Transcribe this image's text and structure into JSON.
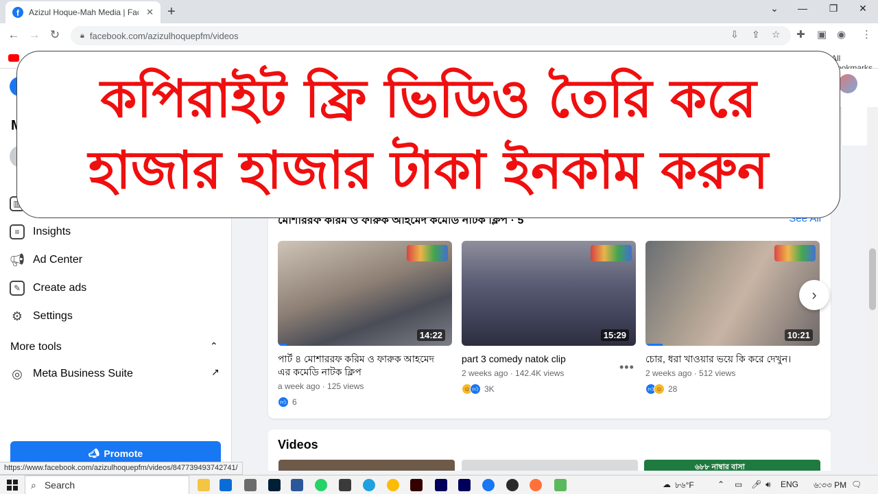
{
  "browser": {
    "tab_title": "Azizul Hoque-Mah Media | Faceb",
    "url": "facebook.com/azizulhoquepfm/videos",
    "bookmarks_label": "All Bookmarks",
    "status_url": "https://www.facebook.com/azizulhoquepfm/videos/847739493742741/"
  },
  "banner": {
    "line1": "কপিরাইট ফ্রি ভিডিও তৈরি করে",
    "line2": "হাজার হাজার টাকা ইনকাম করুন"
  },
  "sidebar": {
    "heading_initial": "M",
    "items": [
      {
        "label": "Insights",
        "icon": "insights-icon"
      },
      {
        "label": "Ad Center",
        "icon": "megaphone-icon"
      },
      {
        "label": "Create ads",
        "icon": "pencil-icon"
      },
      {
        "label": "Settings",
        "icon": "gear-icon"
      }
    ],
    "more_tools": "More tools",
    "meta_business_suite": "Meta Business Suite",
    "promote": "Promote"
  },
  "playlist": {
    "heading": "মোশাররফ করিম ও ফারুক আহমেদ কমেডি নাটক ক্লিপ · 5",
    "see_all": "See All",
    "videos": [
      {
        "duration": "14:22",
        "title": "পার্ট ৪ মোশাররফ করিম ও ফারুক আহমেদ এর কমেডি নাটক ক্লিপ",
        "meta": "a week ago · 125 views",
        "reactions": "6",
        "progress": 0.05
      },
      {
        "duration": "15:29",
        "title": "part 3 comedy natok clip",
        "meta": "2 weeks ago · 142.4K views",
        "reactions": "3K",
        "progress": 0.0
      },
      {
        "duration": "10:21",
        "title": "চোর, ধরা খাওয়ার ভয়ে কি করে দেখুন।",
        "meta": "2 weeks ago · 512 views",
        "reactions": "28",
        "progress": 0.1
      }
    ]
  },
  "videos_section": {
    "heading": "Videos",
    "third_thumb_caption": "৬৮৮ নাম্বার বাসা"
  },
  "taskbar": {
    "search_label": "Search",
    "temperature": "৮৬°F",
    "language": "ENG",
    "time": "৬:৩৩ PM"
  },
  "colors": {
    "facebook_blue": "#1877f2",
    "banner_red": "#ef0f0f"
  }
}
